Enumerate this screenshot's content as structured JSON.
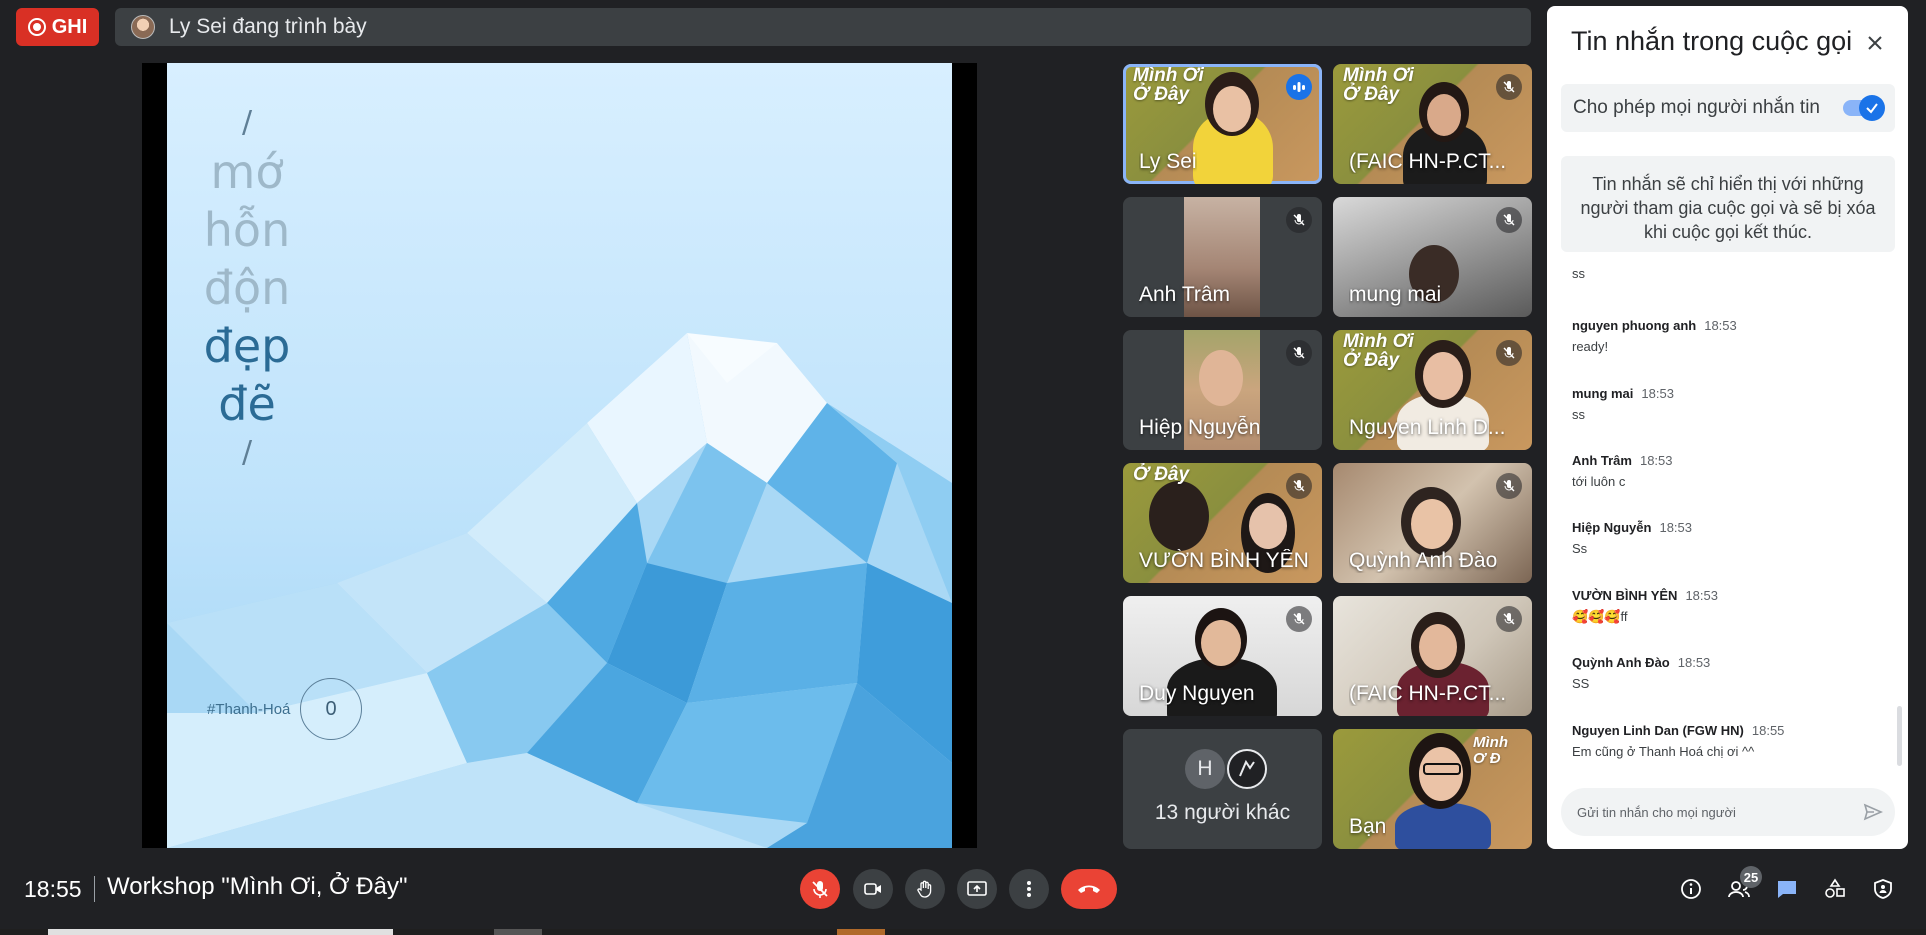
{
  "recording": {
    "label": "GHI"
  },
  "presenter_bar": {
    "text": "Ly Sei đang trình bày"
  },
  "slide": {
    "slash_top": "/",
    "words": [
      "mớ",
      "hỗn",
      "độn",
      "đẹp",
      "đẽ"
    ],
    "slash_bottom": "/",
    "hashtag": "#Thanh-Hoá",
    "counter": "0"
  },
  "participants": [
    {
      "name": "Ly Sei",
      "brand": "Mình Ơi\nỞ Đây",
      "speaking": true
    },
    {
      "name": "(FAIC HN-P.CT...",
      "brand": "Mình Ơi\nỞ Đây",
      "speaking": false
    },
    {
      "name": "Anh Trâm",
      "speaking": false
    },
    {
      "name": "mung mai",
      "speaking": false
    },
    {
      "name": "Hiệp Nguyễn",
      "speaking": false
    },
    {
      "name": "Nguyen Linh D...",
      "brand": "Mình Ơi\nỞ Đây",
      "speaking": false
    },
    {
      "name": "VƯỜN BÌNH YÊN",
      "brand": "Ở Đây",
      "speaking": false
    },
    {
      "name": "Quỳnh Anh Đào",
      "speaking": false
    },
    {
      "name": "Duy Nguyen",
      "speaking": false
    },
    {
      "name": "(FAIC HN-P.CT...",
      "speaking": false
    }
  ],
  "others": {
    "initial": "H",
    "label": "13 người khác"
  },
  "self_tile": {
    "name": "Bạn",
    "brand": "Mình\nƠ Đ"
  },
  "chat": {
    "title": "Tin nhắn trong cuộc gọi",
    "allow_label": "Cho phép mọi người nhắn tin",
    "allow_enabled": true,
    "info": "Tin nhắn sẽ chỉ hiển thị với những người tham gia cuộc gọi và sẽ bị xóa khi cuộc gọi kết thúc.",
    "top_partial": "ss",
    "messages": [
      {
        "sender": "nguyen phuong anh",
        "time": "18:53",
        "text": "ready!"
      },
      {
        "sender": "mung mai",
        "time": "18:53",
        "text": "ss"
      },
      {
        "sender": "Anh Trâm",
        "time": "18:53",
        "text": "tới luôn c"
      },
      {
        "sender": "Hiệp Nguyễn",
        "time": "18:53",
        "text": "Ss"
      },
      {
        "sender": "VƯỜN BÌNH YÊN",
        "time": "18:53",
        "text": "🥰🥰🥰ff"
      },
      {
        "sender": "Quỳnh Anh Đào",
        "time": "18:53",
        "text": "SS"
      },
      {
        "sender": "Nguyen Linh Dan (FGW HN)",
        "time": "18:55",
        "text": "Em cũng ở Thanh Hoá chị ơi ^^"
      }
    ],
    "input_placeholder": "Gửi tin nhắn cho mọi người"
  },
  "bottom": {
    "clock": "18:55",
    "meeting_title": "Workshop \"Mình Ơi, Ở Đây\"",
    "participant_count": "25"
  },
  "colors": {
    "accent": "#1a73e8",
    "danger": "#ea4335",
    "background": "#202124",
    "tile": "#3c4043"
  }
}
